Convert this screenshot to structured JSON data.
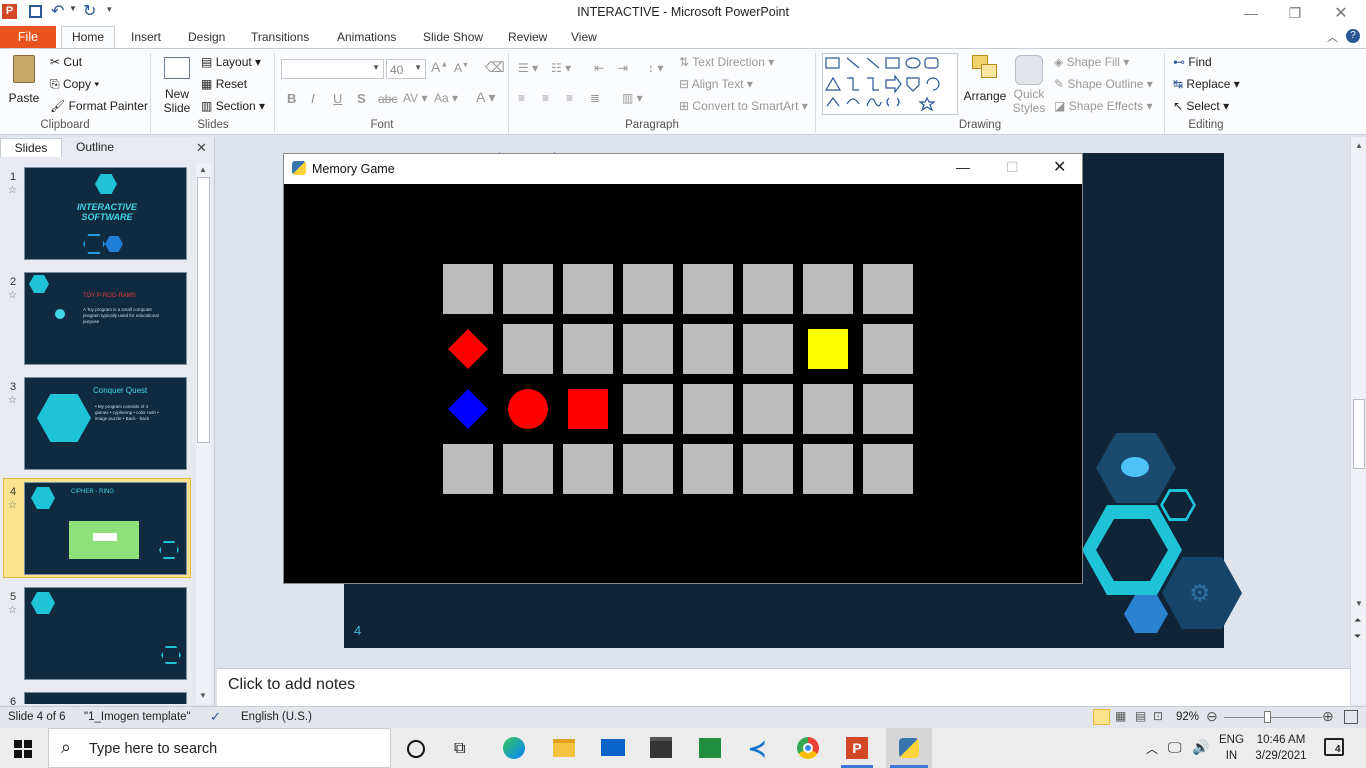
{
  "app": {
    "title": "INTERACTIVE  -  Microsoft PowerPoint"
  },
  "ribbon_tabs": [
    "File",
    "Home",
    "Insert",
    "Design",
    "Transitions",
    "Animations",
    "Slide Show",
    "Review",
    "View"
  ],
  "clipboard": {
    "paste": "Paste",
    "cut": "Cut",
    "copy": "Copy",
    "format_painter": "Format Painter",
    "label": "Clipboard"
  },
  "slides_group": {
    "new_slide_1": "New",
    "new_slide_2": "Slide",
    "layout": "Layout",
    "reset": "Reset",
    "section": "Section",
    "label": "Slides"
  },
  "font_group": {
    "font_size": "40",
    "label": "Font"
  },
  "paragraph_group": {
    "text_direction": "Text Direction",
    "align_text": "Align Text",
    "convert_smartart": "Convert to SmartArt",
    "label": "Paragraph"
  },
  "drawing_group": {
    "arrange": "Arrange",
    "quick_styles_1": "Quick",
    "quick_styles_2": "Styles",
    "shape_fill": "Shape Fill",
    "shape_outline": "Shape Outline",
    "shape_effects": "Shape Effects",
    "label": "Drawing"
  },
  "editing_group": {
    "find": "Find",
    "replace": "Replace",
    "select": "Select",
    "label": "Editing"
  },
  "pane_tabs": {
    "slides": "Slides",
    "outline": "Outline"
  },
  "slide_thumbs": [
    {
      "num": "1",
      "title": "INTERACTIVE SOFTWARE"
    },
    {
      "num": "2",
      "title": "TOY  P-ROG-RAMS",
      "text": "A Toy program  is a small computer program typically used for educational purpose"
    },
    {
      "num": "3",
      "title": "Conquer  Quest",
      "text": "• My program consists of 4 games • cyphering • color rush • image puzzle • Back - back"
    },
    {
      "num": "4",
      "title": "CIPHER - RING"
    },
    {
      "num": "5"
    },
    {
      "num": "6"
    }
  ],
  "slide": {
    "number": "4"
  },
  "game_window": {
    "title": "Memory Game",
    "grid_rows": 4,
    "grid_cols": 8,
    "revealed": [
      {
        "row": 1,
        "col": 0,
        "shape": "diamond",
        "color": "#ff0000"
      },
      {
        "row": 1,
        "col": 6,
        "shape": "square",
        "color": "#ffff00"
      },
      {
        "row": 2,
        "col": 0,
        "shape": "diamond",
        "color": "#0000ff"
      },
      {
        "row": 2,
        "col": 1,
        "shape": "circle",
        "color": "#ff0000"
      },
      {
        "row": 2,
        "col": 2,
        "shape": "square",
        "color": "#ff0000"
      }
    ]
  },
  "notes": {
    "placeholder": "Click to add notes"
  },
  "status": {
    "slide_of": "Slide 4 of 6",
    "template": "\"1_Imogen template\"",
    "language": "English (U.S.)",
    "zoom": "92%"
  },
  "taskbar": {
    "search_placeholder": "Type here to search",
    "lang_1": "ENG",
    "lang_2": "IN",
    "time": "10:46 AM",
    "date": "3/29/2021",
    "notifications": "4"
  },
  "colors": {
    "file_tab": "#e8531f",
    "slide_bg": "#0f2436",
    "card": "#bcbcbc",
    "accent_cyan": "#1fc3d8"
  }
}
